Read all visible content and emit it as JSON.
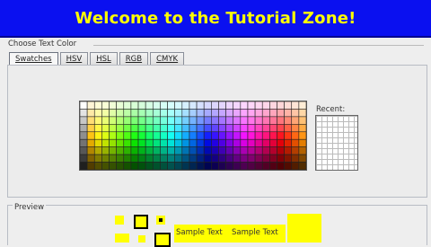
{
  "banner": {
    "title": "Welcome to the Tutorial Zone!"
  },
  "chooser": {
    "title": "Choose Text Color"
  },
  "tabs": [
    {
      "label": "Swatches"
    },
    {
      "label": "HSV"
    },
    {
      "label": "HSL"
    },
    {
      "label": "RGB"
    },
    {
      "label": "CMYK"
    }
  ],
  "swatches": {
    "recent_label": "Recent:"
  },
  "preview": {
    "title": "Preview",
    "sample_text_1": "Sample Text",
    "sample_text_2": "Sample Text"
  },
  "colors": {
    "banner_bg": "#0a10f0",
    "banner_text": "#ffff00",
    "preview_yellow": "#ffff00"
  }
}
